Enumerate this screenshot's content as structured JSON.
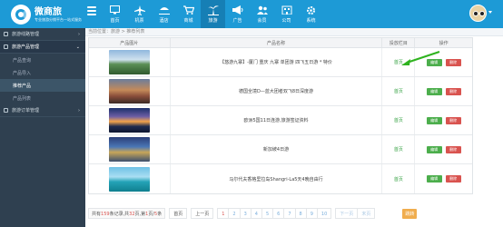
{
  "brand": {
    "title": "微商旅",
    "subtitle": "专业旅游分销平台一站式服务"
  },
  "nav": [
    {
      "label": "首页",
      "icon": "monitor-icon"
    },
    {
      "label": "机票",
      "icon": "plane-icon"
    },
    {
      "label": "酒店",
      "icon": "hotel-icon"
    },
    {
      "label": "商城",
      "icon": "cart-icon"
    },
    {
      "label": "旅游",
      "icon": "palm-tree-icon",
      "active": true
    },
    {
      "label": "广告",
      "icon": "megaphone-icon"
    },
    {
      "label": "会员",
      "icon": "users-icon"
    },
    {
      "label": "公司",
      "icon": "company-icon"
    },
    {
      "label": "系统",
      "icon": "gear-icon"
    }
  ],
  "sidebar": {
    "groups": [
      {
        "label": "旅游线路管理"
      },
      {
        "label": "旅游产品管理"
      },
      {
        "label": "旅游订单管理"
      }
    ],
    "sub_items": [
      {
        "label": "产品查询"
      },
      {
        "label": "产品导入"
      },
      {
        "label": "推荐产品"
      },
      {
        "label": "产品列表"
      }
    ]
  },
  "breadcrumb": "当前位置：旅游 > 推荐列表",
  "table": {
    "headers": [
      "产品图片",
      "产品名称",
      "投放栏目",
      "操作"
    ],
    "rows": [
      {
        "title": "【悠游九寨】-厦门 重庆 九寨 单团游 四飞五日游 * 特价",
        "category": "首页"
      },
      {
        "title": "德国全境D—蓝大团者双飞8日深度游",
        "category": "首页"
      },
      {
        "title": "欧洲5国11日连游,旅游签证资料",
        "category": "首页"
      },
      {
        "title": "新加坡4日游",
        "category": "首页"
      },
      {
        "title": "马尔代夫香格里拉岛Shangri-La5天4晚自由行",
        "category": "首页"
      }
    ],
    "edit_label": "编辑",
    "delete_label": "删除"
  },
  "pager": {
    "prefix": "共有",
    "total_items": "159",
    "mid1": "条记录,共",
    "total_pages": "32",
    "mid2": "页,第",
    "current": "1",
    "mid3": "页/",
    "per_page": "5",
    "suffix": "条",
    "first": "首页",
    "prev": "上一页",
    "pages": [
      "1",
      "2",
      "3",
      "4",
      "5",
      "6",
      "7",
      "8",
      "9",
      "10"
    ],
    "next": "下一页",
    "last": "末页",
    "go": "跳转"
  },
  "colors": {
    "header": "#1d9ad6",
    "sidebar": "#2f4050",
    "edit": "#4cae4c",
    "delete": "#d9534f",
    "go": "#f0ad4e"
  }
}
